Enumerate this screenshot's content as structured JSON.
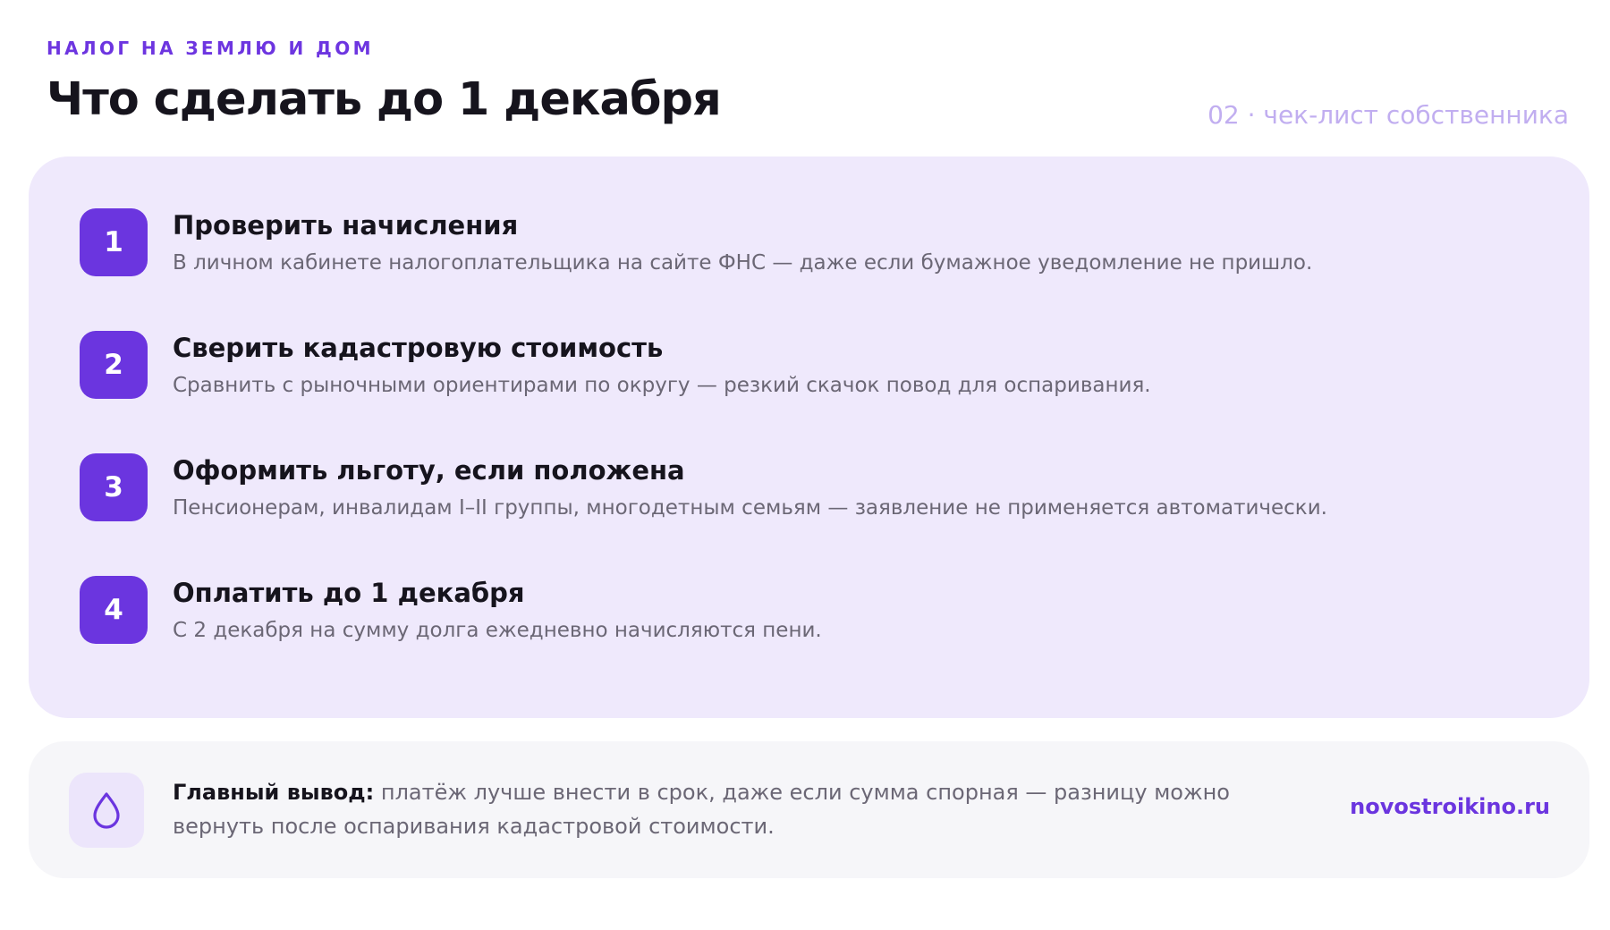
{
  "header": {
    "eyebrow": "НАЛОГ НА ЗЕМЛЮ И ДОМ",
    "title": "Что сделать до 1 декабря",
    "page_tag": "02 · чек-лист собственника"
  },
  "steps": [
    {
      "number": "1",
      "title": "Проверить начисления",
      "description": "В личном кабинете налогоплательщика на сайте ФНС — даже если бумажное уведомление не пришло."
    },
    {
      "number": "2",
      "title": "Сверить кадастровую стоимость",
      "description": "Сравнить с рыночными ориентирами по округу — резкий скачок повод для оспаривания."
    },
    {
      "number": "3",
      "title": "Оформить льготу, если положена",
      "description": "Пенсионерам, инвалидам I–II группы, многодетным семьям — заявление не применяется автоматически."
    },
    {
      "number": "4",
      "title": "Оплатить до 1 декабря",
      "description": "С 2 декабря на сумму долга ежедневно начисляются пени."
    }
  ],
  "summary": {
    "icon": "drop-icon",
    "label": "Главный вывод:",
    "text": " платёж лучше внести в срок, даже если сумма спорная — разницу можно вернуть после оспаривания кадастровой стоимости.",
    "link": "novostroikino.ru"
  },
  "colors": {
    "accent": "#6b35df",
    "card_background": "#efe9fc",
    "summary_background": "#f6f6f9"
  }
}
